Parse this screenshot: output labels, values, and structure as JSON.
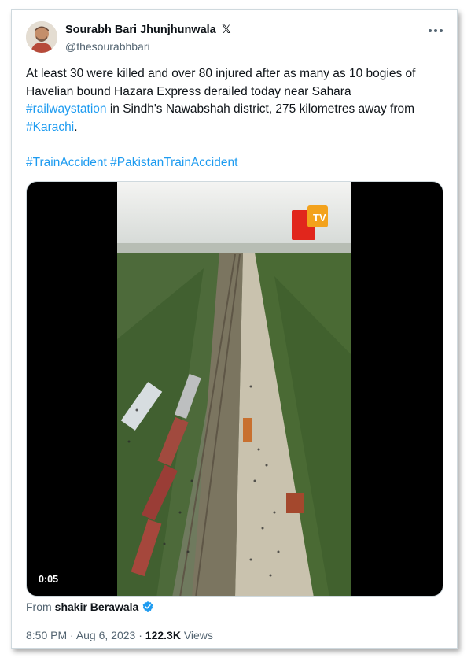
{
  "author": {
    "display_name": "Sourabh Bari Jhunjhunwala",
    "badge_icon": "x-logo-icon",
    "handle": "@thesourabhbari"
  },
  "more_icon": "more-horizontal-icon",
  "tweet": {
    "line1": "At least 30 were killed and over 80 injured after as many as 10 bogies of",
    "line2": "Havelian bound Hazara Express derailed today near Sahara",
    "hashtag_railwaystation": "#railwaystation",
    "line3_rest": " in Sindh's Nawabshah district, 275 kilometres away from",
    "hashtag_karachi": "#Karachi",
    "period": ".",
    "hashtag_trainaccident": "#TrainAccident",
    "hashtag_pakistantrainaccident": "#PakistanTrainAccident"
  },
  "media": {
    "channel_logo_text": "TV",
    "duration": "0:05"
  },
  "source": {
    "prefix": "From",
    "name": "shakir Berawala",
    "verified_icon": "verified-badge-icon"
  },
  "meta": {
    "time": "8:50 PM",
    "separator": " · ",
    "date": "Aug 6, 2023",
    "views_count": "122.3K",
    "views_label": "Views"
  },
  "colors": {
    "link": "#1d9bf0",
    "secondary_text": "#536471",
    "primary_text": "#0f1419",
    "border": "#cfd9de"
  }
}
